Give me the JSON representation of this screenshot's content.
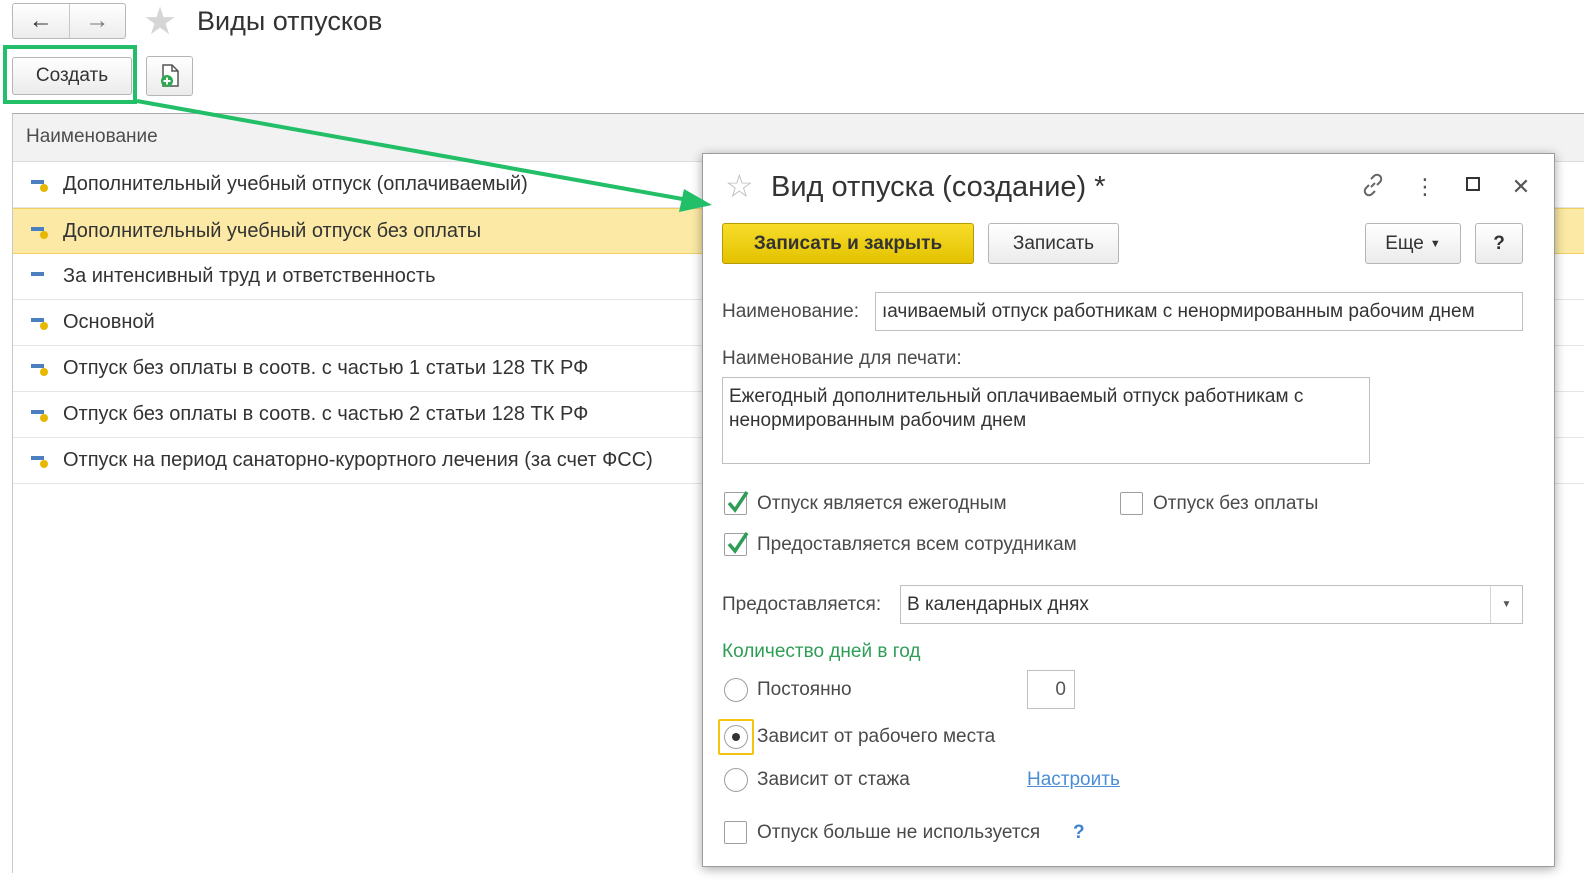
{
  "window": {
    "title": "Виды отпусков",
    "back_icon": "←",
    "forward_icon": "→",
    "star_icon": "★"
  },
  "toolbar": {
    "create_label": "Создать"
  },
  "list": {
    "column_header": "Наименование",
    "rows": [
      {
        "label": "Дополнительный учебный отпуск (оплачиваемый)",
        "icon": "item-with-marker-icon"
      },
      {
        "label": "Дополнительный учебный отпуск без оплаты",
        "icon": "item-with-marker-icon",
        "selected": true
      },
      {
        "label": "За интенсивный труд и ответственность",
        "icon": "item-icon"
      },
      {
        "label": "Основной",
        "icon": "item-with-marker-icon"
      },
      {
        "label": "Отпуск без оплаты в соотв. с частью 1 статьи 128 ТК РФ",
        "icon": "item-with-marker-icon"
      },
      {
        "label": "Отпуск без оплаты в соотв. с частью 2 статьи 128 ТК РФ",
        "icon": "item-with-marker-icon"
      },
      {
        "label": "Отпуск на период санаторно-курортного лечения (за счет ФСС)",
        "icon": "item-with-marker-icon"
      }
    ]
  },
  "dialog": {
    "title": "Вид отпуска (создание) *",
    "star_icon": "☆",
    "link_icon": "🔗",
    "more_icon": "⋮",
    "maximize_icon": "☐",
    "close_icon": "✕",
    "save_close_label": "Записать и закрыть",
    "save_label": "Записать",
    "more_label": "Еще",
    "help_label": "?",
    "name_label": "Наименование:",
    "name_value": "ıачиваемый отпуск работникам с ненормированным рабочим днем",
    "print_name_label": "Наименование для печати:",
    "print_name_value": "Ежегодный дополнительный оплачиваемый отпуск работникам с ненормированным рабочим днем",
    "annual_label": "Отпуск является ежегодным",
    "annual_checked": true,
    "unpaid_label": "Отпуск без оплаты",
    "unpaid_checked": false,
    "all_employees_label": "Предоставляется всем сотрудникам",
    "all_employees_checked": true,
    "provided_label": "Предоставляется:",
    "provided_value": "В календарных днях",
    "days_section_label": "Количество дней в год",
    "constant_label": "Постоянно",
    "constant_value": "0",
    "workplace_label": "Зависит от рабочего места",
    "seniority_label": "Зависит от стажа",
    "configure_link": "Настроить",
    "not_used_label": "Отпуск больше не используется",
    "not_used_checked": false,
    "not_used_help": "?",
    "selected_days_option": "Зависит от рабочего места"
  },
  "colors": {
    "accent_green": "#22bf68",
    "primary_button": "#f0d000",
    "selected_row": "#fbe9a5",
    "section_green": "#2e9e57",
    "link_blue": "#4b8ed6"
  }
}
